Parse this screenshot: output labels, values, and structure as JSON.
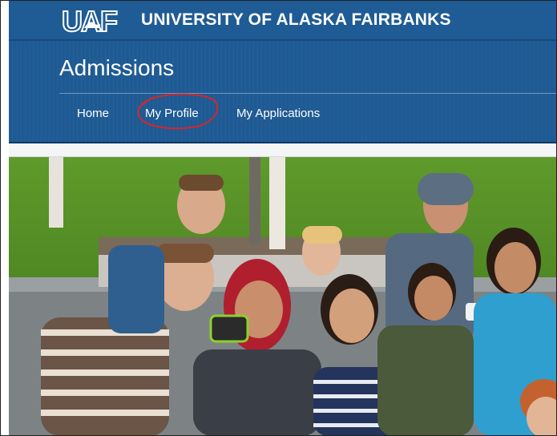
{
  "brand": {
    "logo_text": "UAF",
    "university_name": "UNIVERSITY OF ALASKA FAIRBANKS"
  },
  "page": {
    "title": "Admissions"
  },
  "nav": {
    "items": [
      {
        "label": "Home"
      },
      {
        "label": "My Profile",
        "highlighted": true
      },
      {
        "label": "My Applications"
      }
    ]
  },
  "colors": {
    "header_blue": "#1f5b94",
    "highlight_ring": "#d7262a"
  },
  "hero_image": {
    "icon": "group-photo-students"
  }
}
